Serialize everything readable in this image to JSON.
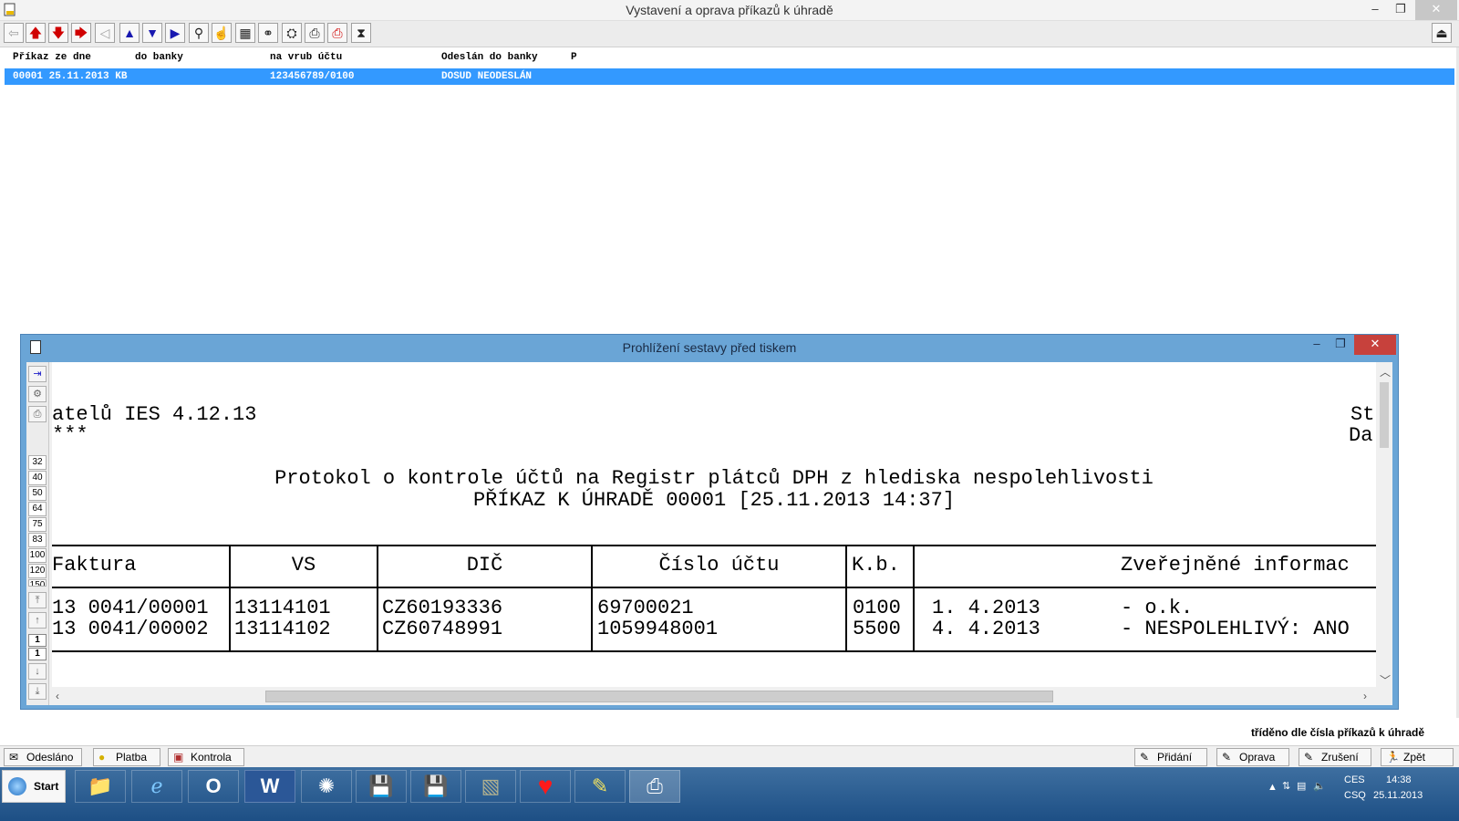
{
  "main_window": {
    "title": "Vystavení a oprava příkazů k úhradě",
    "minimize_glyph": "–",
    "maximize_glyph": "❐",
    "close_glyph": "✕"
  },
  "toolbar": {
    "buttons": [
      {
        "name": "back-arrow-icon",
        "glyph": "⇦"
      },
      {
        "name": "move-up-red-icon",
        "glyph": "🡅"
      },
      {
        "name": "move-down-red-icon",
        "glyph": "🡇"
      },
      {
        "name": "move-right-red-icon",
        "glyph": "🡆"
      },
      {
        "name": "left-triangle-icon",
        "glyph": "◁"
      },
      {
        "name": "up-blue-icon",
        "glyph": "▲"
      },
      {
        "name": "down-blue-icon",
        "glyph": "▼"
      },
      {
        "name": "right-blue-icon",
        "glyph": "▶"
      },
      {
        "name": "pin-icon",
        "glyph": "⚲"
      },
      {
        "name": "hand-icon",
        "glyph": "☝"
      },
      {
        "name": "grid-icon",
        "glyph": "▦"
      },
      {
        "name": "binoculars-icon",
        "glyph": "⚭"
      },
      {
        "name": "tag-icon",
        "glyph": "⛭"
      },
      {
        "name": "printer-icon",
        "glyph": "⎙"
      },
      {
        "name": "printer-red-icon",
        "glyph": "⎙"
      },
      {
        "name": "hourglass-icon",
        "glyph": "⧗"
      }
    ],
    "exit_glyph": "⏏"
  },
  "list": {
    "headers": {
      "col1": "Příkaz ze dne",
      "col2": "do banky",
      "col3": "na vrub účtu",
      "col4": "Odeslán do banky",
      "col5": "P"
    },
    "rows": [
      {
        "col1": "00001 25.11.2013 KB",
        "col3": "123456789/0100",
        "col4": "DOSUD NEODESLÁN"
      }
    ]
  },
  "preview_dialog": {
    "title": "Prohlížení sestavy před tiskem",
    "zoom_levels": [
      "32",
      "40",
      "50",
      "64",
      "75",
      "83",
      "100",
      "120",
      "150"
    ],
    "page_indicators": [
      "1",
      "1"
    ],
    "report": {
      "header_left_1": "atelů IES 4.12.13",
      "header_left_2": "***",
      "header_right_1": "St",
      "header_right_2": "Da",
      "title": "Protokol o kontrole účtů na Registr plátců DPH z hlediska nespolehlivosti",
      "subtitle": "PŘÍKAZ K ÚHRADĚ 00001 [25.11.2013 14:37]",
      "columns": [
        "Faktura",
        "VS",
        "DIČ",
        "Číslo účtu",
        "K.b.",
        "Zveřejněné informac"
      ],
      "rows": [
        {
          "faktura": "13 0041/00001",
          "vs": "13114101",
          "dic": "CZ60193336",
          "ucet": "69700021",
          "kb": "0100",
          "date": "1. 4.2013",
          "info": "- o.k."
        },
        {
          "faktura": "13 0041/00002",
          "vs": "13114102",
          "dic": "CZ60748991",
          "ucet": "1059948001",
          "kb": "5500",
          "date": "4. 4.2013",
          "info": "- NESPOLEHLIVÝ: ANO"
        }
      ]
    }
  },
  "status": {
    "sort_note": "tříděno dle čísla příkazů k úhradě"
  },
  "bottom_buttons": {
    "left": [
      {
        "label": "Odesláno",
        "glyph": "✉"
      },
      {
        "label": "Platba",
        "glyph": "●"
      },
      {
        "label": "Kontrola",
        "glyph": "▣"
      }
    ],
    "right": [
      {
        "label": "Přidání",
        "glyph": "✎"
      },
      {
        "label": "Oprava",
        "glyph": "✎"
      },
      {
        "label": "Zrušení",
        "glyph": "✎"
      },
      {
        "label": "Zpět",
        "glyph": "🏃"
      }
    ]
  },
  "taskbar": {
    "start_label": "Start",
    "apps": [
      {
        "name": "file-explorer-icon",
        "glyph": "📁"
      },
      {
        "name": "internet-explorer-icon",
        "glyph": "ℯ"
      },
      {
        "name": "outlook-icon",
        "glyph": "O"
      },
      {
        "name": "word-icon",
        "glyph": "W"
      },
      {
        "name": "app-runner-icon",
        "glyph": "✺"
      },
      {
        "name": "floppy-red-icon",
        "glyph": "💾"
      },
      {
        "name": "floppy-blue-icon",
        "glyph": "💾"
      },
      {
        "name": "photo-icon",
        "glyph": "▧"
      },
      {
        "name": "heart-icon",
        "glyph": "♥"
      },
      {
        "name": "notepad-icon",
        "glyph": "✎"
      },
      {
        "name": "printer-app-icon",
        "glyph": "⎙"
      }
    ],
    "tray": {
      "lang_top": "CES",
      "lang_bottom": "CSQ",
      "time": "14:38",
      "date": "25.11.2013"
    }
  }
}
